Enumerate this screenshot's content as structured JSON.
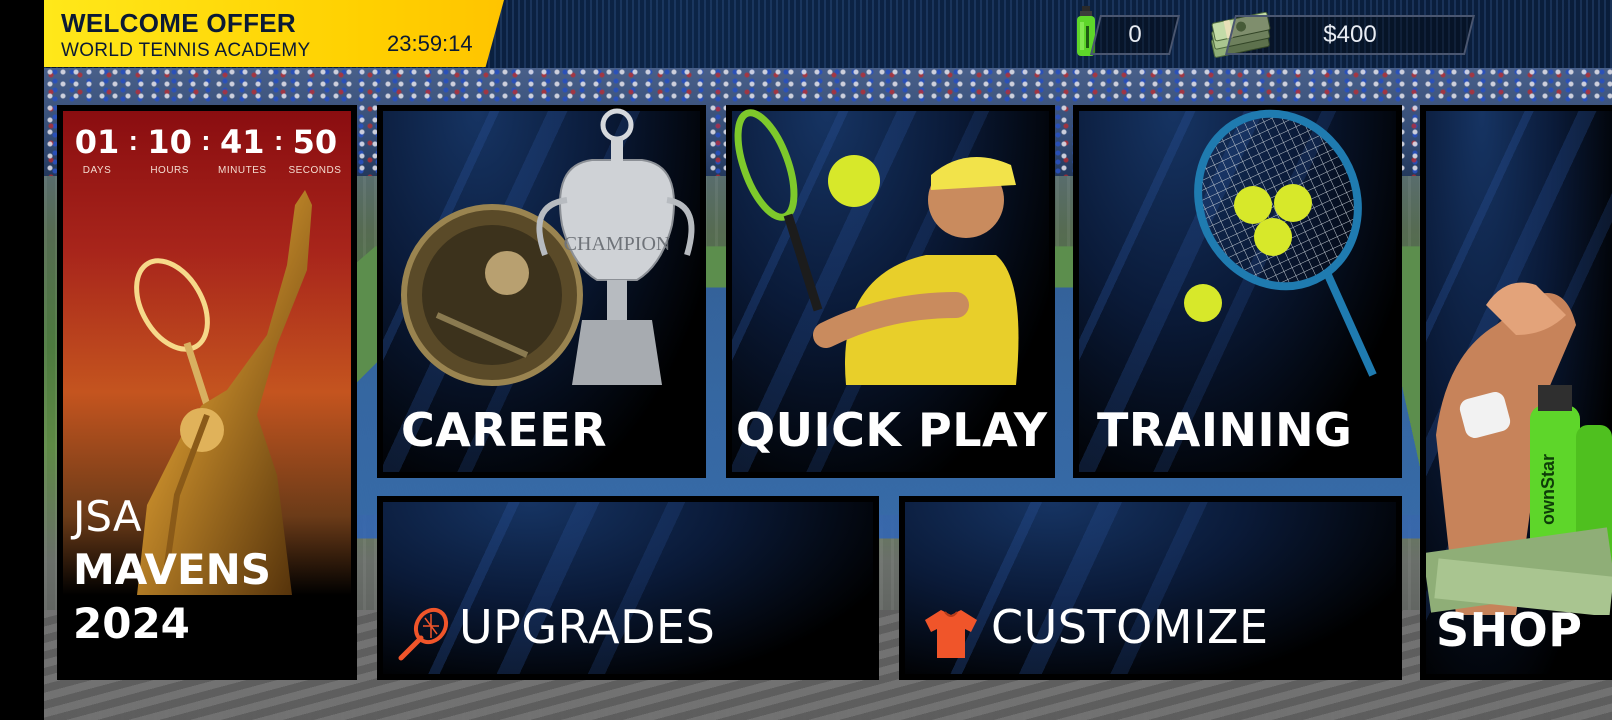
{
  "offer": {
    "title": "WELCOME OFFER",
    "subtitle": "WORLD TENNIS ACADEMY",
    "timer": "23:59:14"
  },
  "currency": {
    "bottles": "0",
    "cash": "$400"
  },
  "event": {
    "countdown": [
      {
        "value": "01",
        "caption": "DAYS"
      },
      {
        "value": "10",
        "caption": "HOURS"
      },
      {
        "value": "41",
        "caption": "MINUTES"
      },
      {
        "value": "50",
        "caption": "SECONDS"
      }
    ],
    "title_line1": "JSA",
    "title_line2": "MAVENS",
    "title_line3": "2024"
  },
  "menu": {
    "career": "CAREER",
    "quick_play": "QUICK PLAY",
    "training": "TRAINING",
    "upgrades": "UPGRADES",
    "customize": "CUSTOMIZE",
    "shop": "SHOP"
  },
  "icons": {
    "bottle": "bottle-icon",
    "cash": "cash-icon",
    "racket": "racket-icon",
    "shirt": "shirt-icon"
  },
  "colors": {
    "offer_yellow": "#ffd000",
    "tile_black": "#000000",
    "ball_yellow": "#d7e82a",
    "bottle_green": "#5ed62a",
    "accent_orange": "#f0552a"
  }
}
